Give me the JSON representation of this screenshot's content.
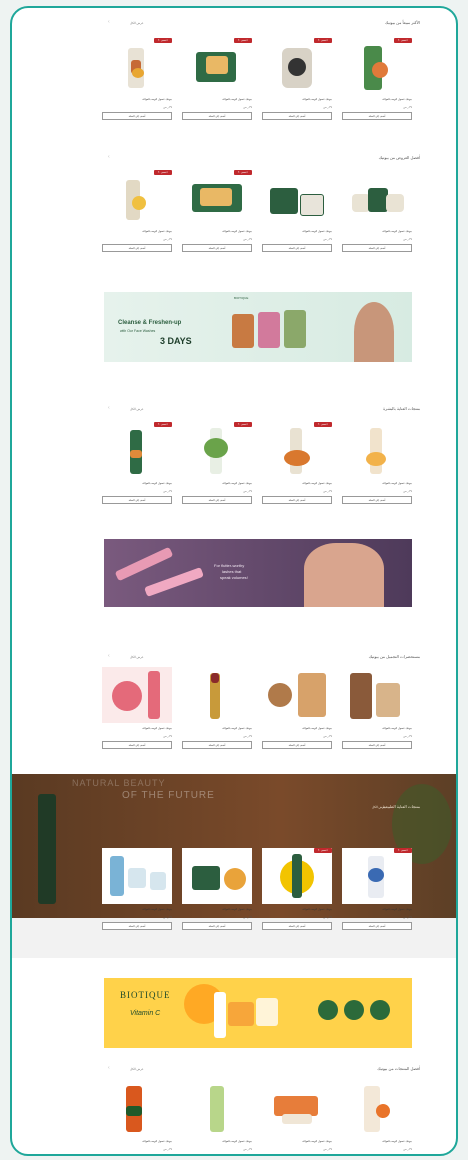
{
  "sections": [
    {
      "title": "الأكثر مبيعاً من بيوتيك",
      "view_all": "عرض الكل"
    },
    {
      "title": "أفضل العروض من بيوتيك",
      "view_all": ""
    },
    {
      "title": "منتجات العناية بالبشرة",
      "view_all": "عرض الكل"
    },
    {
      "title": "مستحضرات التجميل من بيوتيك",
      "view_all": "عرض الكل"
    },
    {
      "title": "منتجات العناية الطبيعية",
      "view_all": "عرض الكل"
    },
    {
      "title": "أفضل المنتجات من بيوتيك",
      "view_all": "عرض الكل"
    }
  ],
  "product": {
    "badge": "خصم ٢٠٪",
    "name": "بيوتيك غسول الوجه بالفواكه",
    "price": "٣٩ ر.س",
    "button": "أضف إلى السلة"
  },
  "banner1": {
    "brand": "BIOTIQUE",
    "line1": "Cleanse & Freshen-up",
    "line2": "with Our Face Washes",
    "line3": "3 DAYS"
  },
  "banner2": {
    "line1": "For flutter-worthy",
    "line2": "lashes that",
    "line3": "speak volumes!"
  },
  "banner3": {
    "line1": "NATURAL BEAUTY",
    "line2": "OF THE FUTURE"
  },
  "banner4": {
    "brand": "BIOTIQUE",
    "sub": "Vitamin C"
  },
  "colors": {
    "accent": "#1fa79a",
    "badge": "#c0292d"
  }
}
